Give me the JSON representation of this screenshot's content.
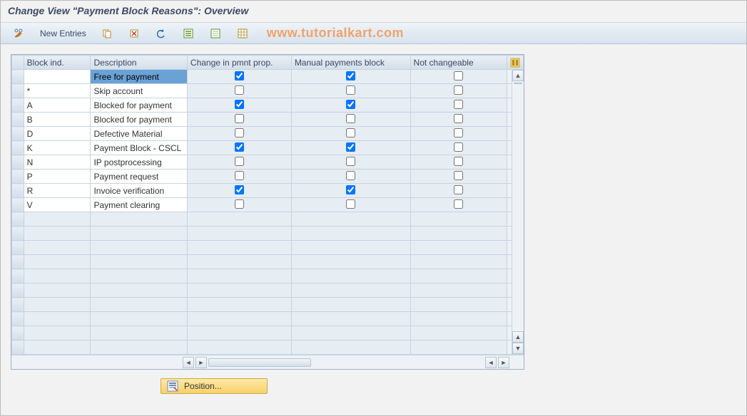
{
  "title": "Change View \"Payment Block Reasons\": Overview",
  "watermark": "www.tutorialkart.com",
  "toolbar": {
    "new_entries": "New Entries"
  },
  "table": {
    "headers": {
      "block_ind": "Block ind.",
      "description": "Description",
      "change_pmnt": "Change in pmnt prop.",
      "manual_block": "Manual payments block",
      "not_changeable": "Not changeable"
    },
    "rows": [
      {
        "ind": "",
        "desc": "Free for payment",
        "chg": true,
        "man": true,
        "not": false,
        "selected_desc": true
      },
      {
        "ind": "*",
        "desc": "Skip account",
        "chg": false,
        "man": false,
        "not": false
      },
      {
        "ind": "A",
        "desc": "Blocked for payment",
        "chg": true,
        "man": true,
        "not": false
      },
      {
        "ind": "B",
        "desc": "Blocked for payment",
        "chg": false,
        "man": false,
        "not": false
      },
      {
        "ind": "D",
        "desc": "Defective Material",
        "chg": false,
        "man": false,
        "not": false
      },
      {
        "ind": "K",
        "desc": "Payment Block - CSCL",
        "chg": true,
        "man": true,
        "not": false
      },
      {
        "ind": "N",
        "desc": "IP postprocessing",
        "chg": false,
        "man": false,
        "not": false
      },
      {
        "ind": "P",
        "desc": "Payment request",
        "chg": false,
        "man": false,
        "not": false
      },
      {
        "ind": "R",
        "desc": "Invoice verification",
        "chg": true,
        "man": true,
        "not": false
      },
      {
        "ind": "V",
        "desc": "Payment clearing",
        "chg": false,
        "man": false,
        "not": false
      }
    ],
    "empty_row_count": 10
  },
  "position_button": "Position..."
}
